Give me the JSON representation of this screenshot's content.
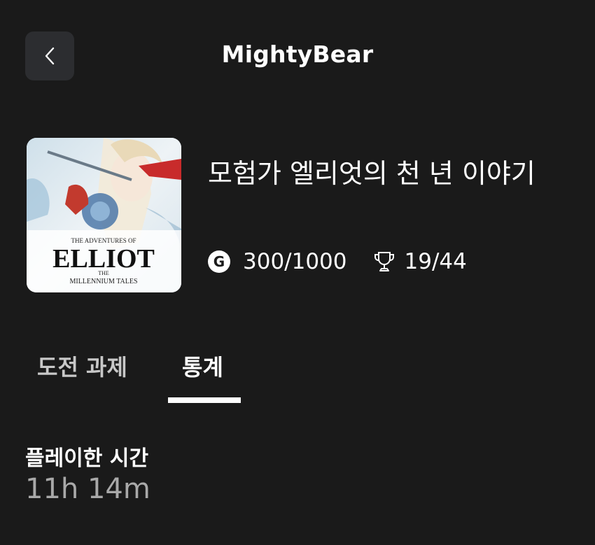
{
  "header": {
    "back_icon": "chevron-left-icon",
    "title": "MightyBear"
  },
  "game": {
    "cover_art": {
      "line1": "THE ADVENTURES OF",
      "line2": "ELLIOT",
      "line3": "THE",
      "line4": "MILLENNIUM TALES"
    },
    "title": "모험가 엘리엇의 천 년 이야기",
    "gamerscore": {
      "icon": "gamerscore-g-icon",
      "badge_letter": "G",
      "value": "300/1000"
    },
    "achievements": {
      "icon": "trophy-icon",
      "value": "19/44"
    }
  },
  "tabs": [
    {
      "label": "도전 과제",
      "active": false
    },
    {
      "label": "통계",
      "active": true
    }
  ],
  "stats": {
    "playtime_label": "플레이한 시간",
    "playtime_value": "11h 14m"
  },
  "colors": {
    "background": "#1a1a1a",
    "button_bg": "#2c2d30",
    "text_primary": "#ffffff",
    "text_secondary": "#a9a9a9",
    "tab_inactive": "#c8c8c8"
  }
}
